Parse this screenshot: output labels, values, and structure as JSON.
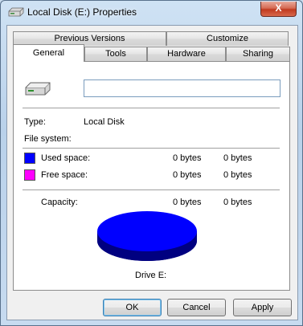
{
  "window": {
    "title": "Local Disk (E:) Properties",
    "close_glyph": "X"
  },
  "tabs_back": [
    "Previous Versions",
    "Customize"
  ],
  "tabs_front": [
    "General",
    "Tools",
    "Hardware",
    "Sharing"
  ],
  "active_tab": "General",
  "general": {
    "name_value": "",
    "type_label": "Type:",
    "type_value": "Local Disk",
    "filesystem_label": "File system:",
    "filesystem_value": "",
    "used": {
      "label": "Used space:",
      "bytes": "0 bytes",
      "size": "0 bytes",
      "color": "#0000ff"
    },
    "free": {
      "label": "Free space:",
      "bytes": "0 bytes",
      "size": "0 bytes",
      "color": "#ff00ff"
    },
    "capacity": {
      "label": "Capacity:",
      "bytes": "0 bytes",
      "size": "0 bytes"
    },
    "drive_label": "Drive E:"
  },
  "buttons": {
    "ok": "OK",
    "cancel": "Cancel",
    "apply": "Apply"
  }
}
